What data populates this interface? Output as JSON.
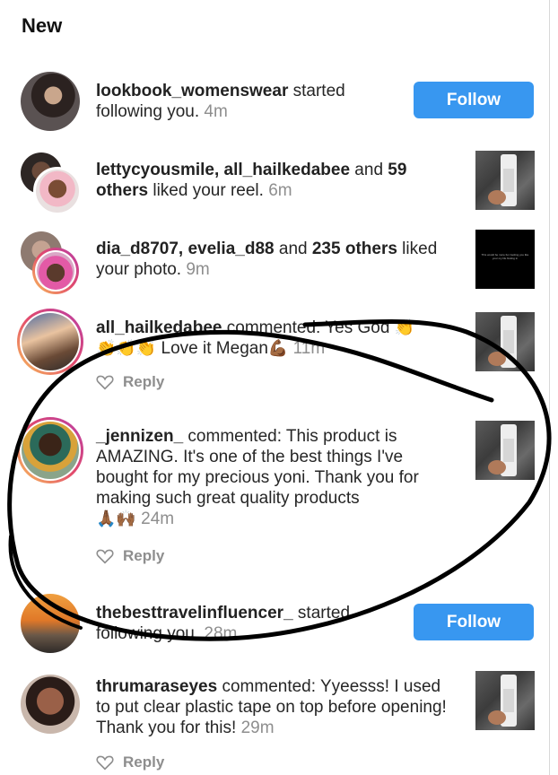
{
  "header": {
    "title": "New"
  },
  "notifications": [
    {
      "id": "n1",
      "user": "lookbook_womenswear",
      "action": " started following you.",
      "time": "4m",
      "button": "Follow"
    },
    {
      "id": "n2",
      "users": "lettycyousmile, all_hailkedabee",
      "joiner": " and ",
      "others": "59 others",
      "action": " liked your reel.",
      "time": "6m"
    },
    {
      "id": "n3",
      "users": "dia_d8707, evelia_d88",
      "joiner": " and ",
      "others": "235 others",
      "action": " liked your photo.",
      "time": "9m",
      "thumb_text": "This would be more fun Getting you like your my life finding in"
    },
    {
      "id": "n4",
      "user": "all_hailkedabee",
      "action": " commented: Yes God",
      "emoji_clap": "👏",
      "love": " Love it Megan",
      "emoji_arm": "💪🏾",
      "time": "11m",
      "reply": "Reply"
    },
    {
      "id": "n5",
      "user": "_jennizen_",
      "action": " commented: This product is AMAZING. It's one of the best things I've bought for my precious yoni. Thank you for making such great quality products",
      "emoji_pray": "🙏🏾",
      "emoji_raise": "🙌🏾",
      "time": "24m",
      "reply": "Reply"
    },
    {
      "id": "n6",
      "user": "thebesttravelinfluencer_",
      "action": " started following you.",
      "time": "28m",
      "button": "Follow"
    },
    {
      "id": "n7",
      "user": "thrumaraseyes",
      "action": " commented: Yyeesss! I used to put clear plastic tape on top before opening! Thank you for this!",
      "time": "29m",
      "reply": "Reply"
    }
  ],
  "colors": {
    "button": "#3897f0",
    "time": "#8e8e8e",
    "text": "#262626"
  }
}
